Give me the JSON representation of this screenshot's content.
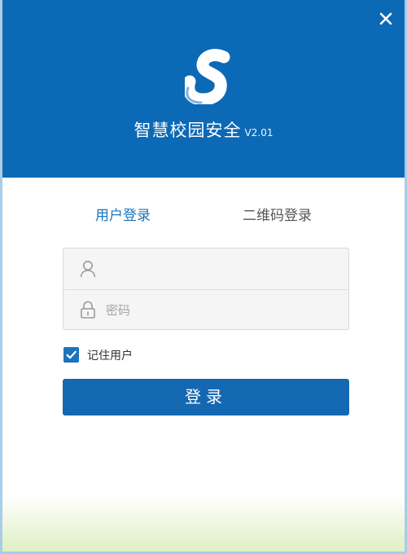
{
  "app": {
    "title": "智慧校园安全",
    "version": "V2.01"
  },
  "window_controls": {
    "close_icon": "close-icon"
  },
  "tabs": [
    {
      "label": "用户登录",
      "active": true
    },
    {
      "label": "二维码登录",
      "active": false
    }
  ],
  "form": {
    "username": {
      "value": "",
      "placeholder": "",
      "icon": "user-icon"
    },
    "password": {
      "value": "",
      "placeholder": "密码",
      "icon": "lock-icon"
    },
    "remember": {
      "label": "记住用户",
      "checked": true
    }
  },
  "login_button": {
    "label": "登录"
  },
  "colors": {
    "header": "#0c69b6",
    "accent": "#1468b1",
    "active_tab": "#1d73b8"
  }
}
